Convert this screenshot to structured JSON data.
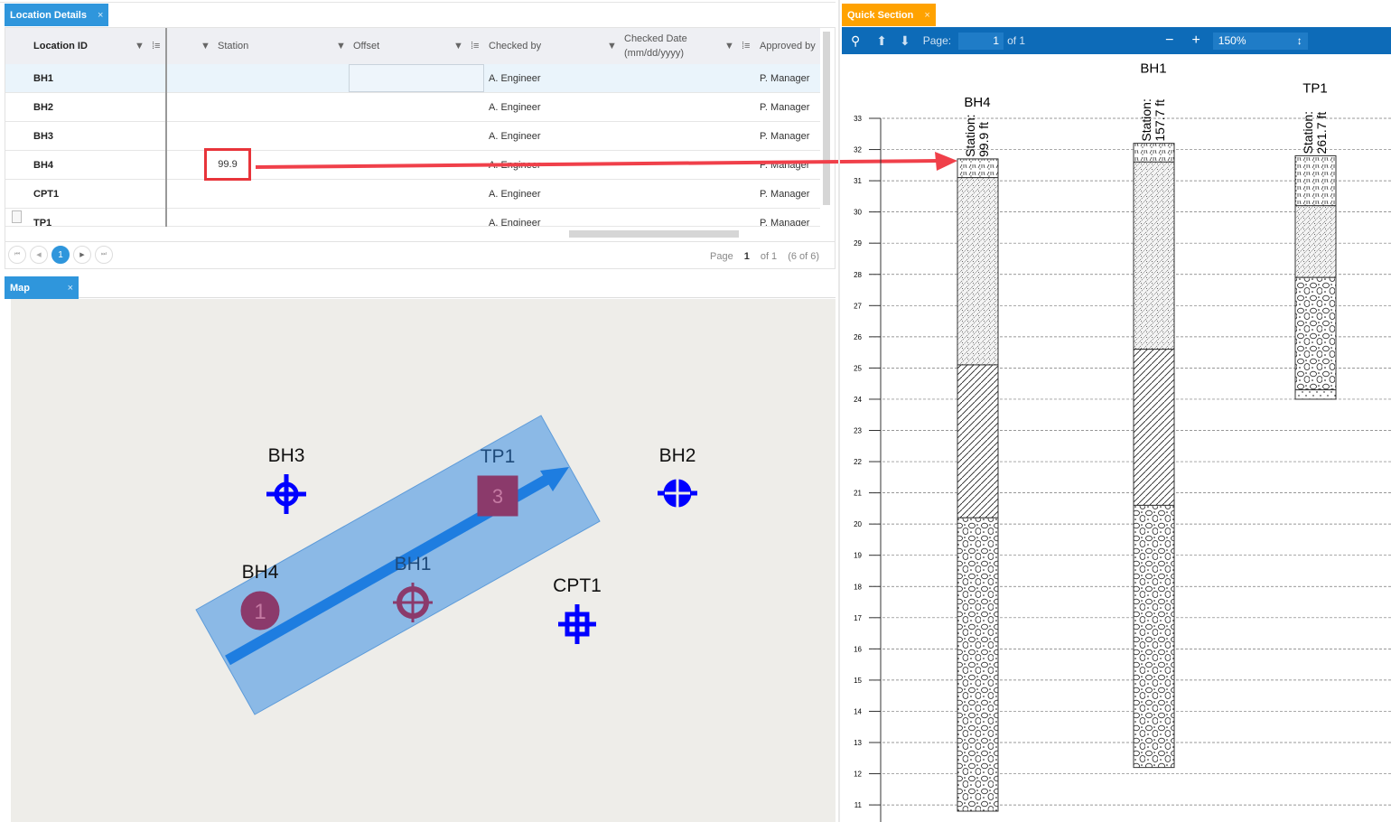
{
  "location_tab": {
    "title": "Location Details",
    "close": "×"
  },
  "grid": {
    "columns": [
      "Location ID",
      "Station",
      "Offset",
      "Checked by",
      "Checked Date (mm/dd/yyyy)",
      "Approved by"
    ],
    "checked_date_line1": "Checked Date",
    "checked_date_line2": "(mm/dd/yyyy)",
    "rows": [
      {
        "id": "BH1",
        "station": "",
        "offset": "",
        "checked": "A. Engineer",
        "date": "",
        "approved": "P. Manager"
      },
      {
        "id": "BH2",
        "station": "",
        "offset": "",
        "checked": "A. Engineer",
        "date": "",
        "approved": "P. Manager"
      },
      {
        "id": "BH3",
        "station": "",
        "offset": "",
        "checked": "A. Engineer",
        "date": "",
        "approved": "P. Manager"
      },
      {
        "id": "BH4",
        "station": "99.9",
        "offset": "",
        "checked": "A. Engineer",
        "date": "",
        "approved": "P. Manager"
      },
      {
        "id": "CPT1",
        "station": "",
        "offset": "",
        "checked": "A. Engineer",
        "date": "",
        "approved": "P. Manager"
      },
      {
        "id": "TP1",
        "station": "",
        "offset": "",
        "checked": "A. Engineer",
        "date": "",
        "approved": "P. Manager"
      }
    ],
    "pager": {
      "current": "1",
      "page_label": "Page",
      "page": "1",
      "of": "of 1",
      "count": "(6 of 6)"
    }
  },
  "map_tab": {
    "title": "Map",
    "close": "×"
  },
  "map": {
    "labels": [
      "BH3",
      "TP1",
      "BH2",
      "BH4",
      "BH1",
      "CPT1"
    ],
    "colors": {
      "bg": "#eeede9",
      "symbol": "#0000ff",
      "section": "#7fb2e5",
      "arrow": "#1e7de0",
      "pick": "#8b3a6b"
    }
  },
  "quick_tab": {
    "title": "Quick Section",
    "close": "×"
  },
  "toolbar": {
    "page_label": "Page:",
    "page": "1",
    "of": "of 1",
    "zoom": "150%",
    "minus": "−",
    "plus": "+"
  },
  "chart_data": {
    "type": "section",
    "ylim": [
      11,
      33
    ],
    "yticks": [
      33,
      32,
      31,
      30,
      29,
      28,
      27,
      26,
      25,
      24,
      23,
      22,
      21,
      20,
      19,
      18,
      17,
      16,
      15,
      14,
      13,
      12,
      11
    ],
    "logs": [
      {
        "name": "BH4",
        "station": "Station:",
        "station_val": "99.9 ft",
        "layers": [
          [
            31.7,
            31.1,
            "topsoil"
          ],
          [
            31.1,
            25.1,
            "silt"
          ],
          [
            25.1,
            20.2,
            "clay"
          ],
          [
            20.2,
            10.8,
            "gravel"
          ]
        ]
      },
      {
        "name": "BH1",
        "station": "Station:",
        "station_val": "157.7 ft",
        "layers": [
          [
            32.2,
            31.6,
            "topsoil"
          ],
          [
            31.6,
            25.6,
            "silt"
          ],
          [
            25.6,
            20.6,
            "clay"
          ],
          [
            20.6,
            12.2,
            "gravel"
          ]
        ]
      },
      {
        "name": "TP1",
        "station": "Station:",
        "station_val": "261.7 ft",
        "layers": [
          [
            31.8,
            30.2,
            "topsoil"
          ],
          [
            30.2,
            27.9,
            "silt"
          ],
          [
            27.9,
            24.3,
            "gravel"
          ],
          [
            24.3,
            24.0,
            "sand"
          ]
        ]
      }
    ]
  }
}
